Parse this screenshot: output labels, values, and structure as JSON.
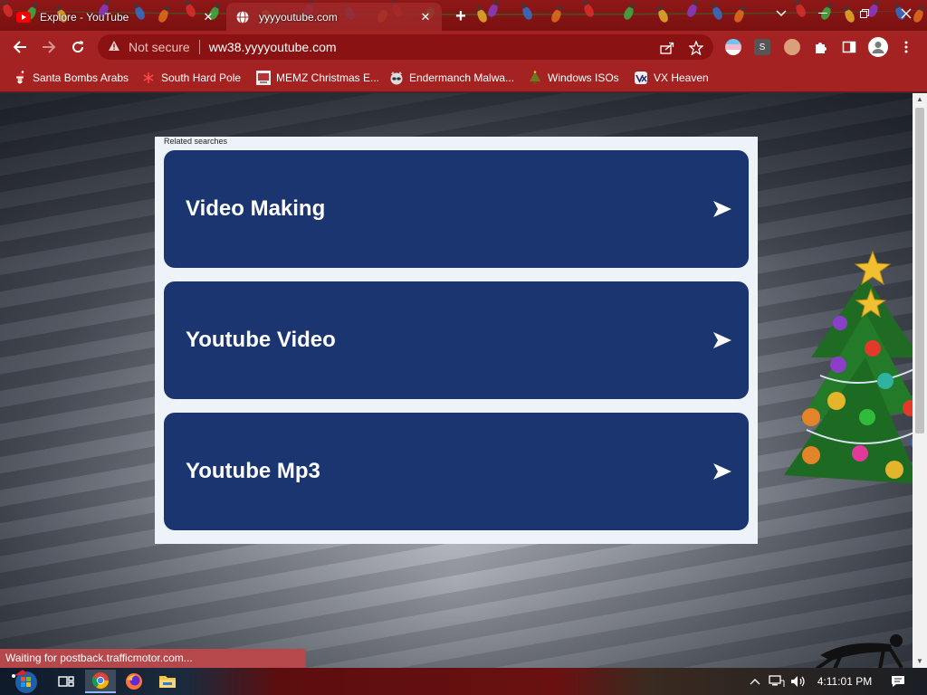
{
  "browser": {
    "tabs": [
      {
        "title": "Explore - YouTube",
        "favicon": "youtube-icon",
        "active": false
      },
      {
        "title": "yyyyoutube.com",
        "favicon": "globe-icon",
        "active": true
      }
    ],
    "new_tab_icon": "plus-icon",
    "window_controls": [
      "chevron-down-icon",
      "minimize-icon",
      "restore-icon",
      "close-icon"
    ],
    "toolbar": {
      "back_icon": "back-arrow-icon",
      "forward_icon": "forward-arrow-icon",
      "reload_icon": "reload-icon",
      "security_label": "Not secure",
      "url": "ww38.yyyyoutube.com",
      "share_icon": "share-icon",
      "bookmark_icon": "star-icon",
      "extension_letter": "S"
    },
    "bookmarks": [
      {
        "label": "Santa Bombs Arabs",
        "icon": "santa-icon"
      },
      {
        "label": "South Hard Pole",
        "icon": "snowflake-icon"
      },
      {
        "label": "MEMZ Christmas E...",
        "icon": "memz-icon"
      },
      {
        "label": "Endermanch Malwa...",
        "icon": "raccoon-icon"
      },
      {
        "label": "Windows ISOs",
        "icon": "tree-icon"
      },
      {
        "label": "VX Heaven",
        "icon": "vx-icon"
      }
    ]
  },
  "page": {
    "related_label": "Related searches",
    "searches": [
      {
        "label": "Video Making"
      },
      {
        "label": "Youtube Video"
      },
      {
        "label": "Youtube Mp3"
      }
    ],
    "colors": {
      "card": "#1b3570",
      "panel": "#eef3fa",
      "chrome": "#a52222"
    }
  },
  "status_text": "Waiting for postback.trafficmotor.com...",
  "taskbar": {
    "items": [
      "start-orb-icon",
      "task-view-icon",
      "chrome-icon",
      "firefox-icon",
      "file-explorer-icon"
    ],
    "clock": "4:11:01 PM"
  }
}
